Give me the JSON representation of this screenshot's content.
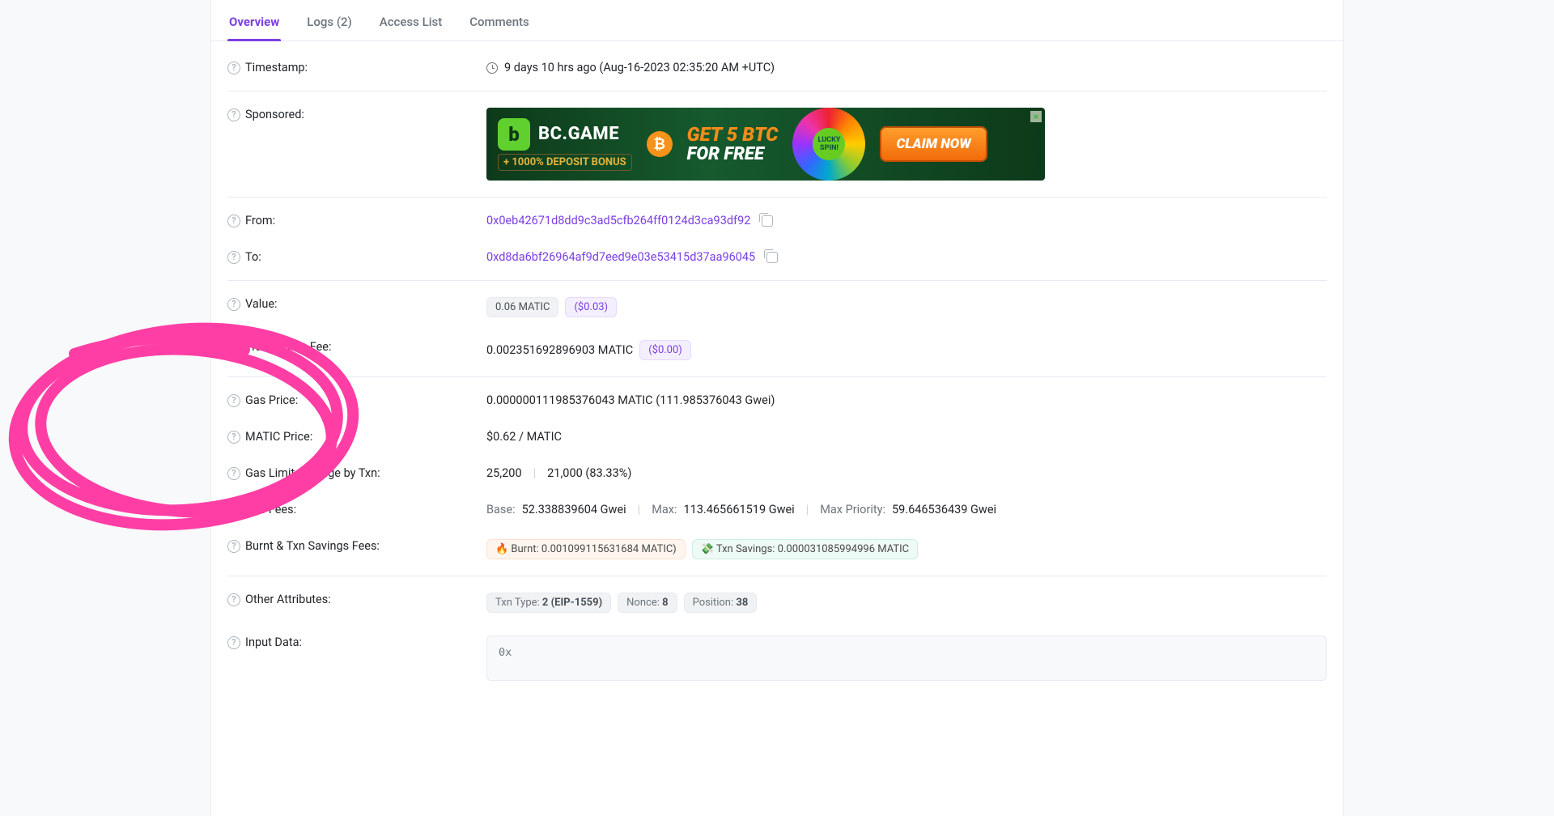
{
  "tabs": {
    "overview": "Overview",
    "logs": "Logs (2)",
    "access": "Access List",
    "comments": "Comments"
  },
  "labels": {
    "timestamp": "Timestamp:",
    "sponsored": "Sponsored:",
    "from": "From:",
    "to": "To:",
    "value": "Value:",
    "txnFee": "Transaction Fee:",
    "gasPrice": "Gas Price:",
    "maticPrice": "MATIC Price:",
    "gasLimitUsage": "Gas Limit & Usage by Txn:",
    "gasFees": "Gas Fees:",
    "burnt": "Burnt & Txn Savings Fees:",
    "otherAttrs": "Other Attributes:",
    "inputData": "Input Data:"
  },
  "values": {
    "timestamp": "9 days 10 hrs ago (Aug-16-2023 02:35:20 AM +UTC)",
    "from": "0x0eb42671d8dd9c3ad5cfb264ff0124d3ca93df92",
    "to": "0xd8da6bf26964af9d7eed9e03e53415d37aa96045",
    "valueAmt": "0.06 MATIC",
    "valueUsd": "($0.03)",
    "txnFeeAmt": "0.002351692896903 MATIC",
    "txnFeeUsd": "($0.00)",
    "gasPrice": "0.000000111985376043 MATIC (111.985376043 Gwei)",
    "maticPrice": "$0.62 / MATIC",
    "gasLimit": "25,200",
    "gasUsed": "21,000 (83.33%)",
    "baseLabel": "Base:",
    "baseVal": "52.338839604 Gwei",
    "maxLabel": "Max:",
    "maxVal": "113.465661519 Gwei",
    "maxPrioLabel": "Max Priority:",
    "maxPrioVal": "59.646536439 Gwei",
    "burntPill": "🔥 Burnt: 0.001099115631684 MATIC)",
    "savingsPill": "💸 Txn Savings: 0.000031085994996 MATIC",
    "txnType": "Txn Type:",
    "txnTypeVal": "2 (EIP-1559)",
    "nonce": "Nonce:",
    "nonceVal": "8",
    "position": "Position:",
    "positionVal": "38",
    "inputDataVal": "0x"
  },
  "ad": {
    "brand": "BC.GAME",
    "bonus": "+ 1000% DEPOSIT BONUS",
    "line1": "GET 5 BTC",
    "line2": "FOR FREE",
    "cta": "CLAIM NOW"
  }
}
